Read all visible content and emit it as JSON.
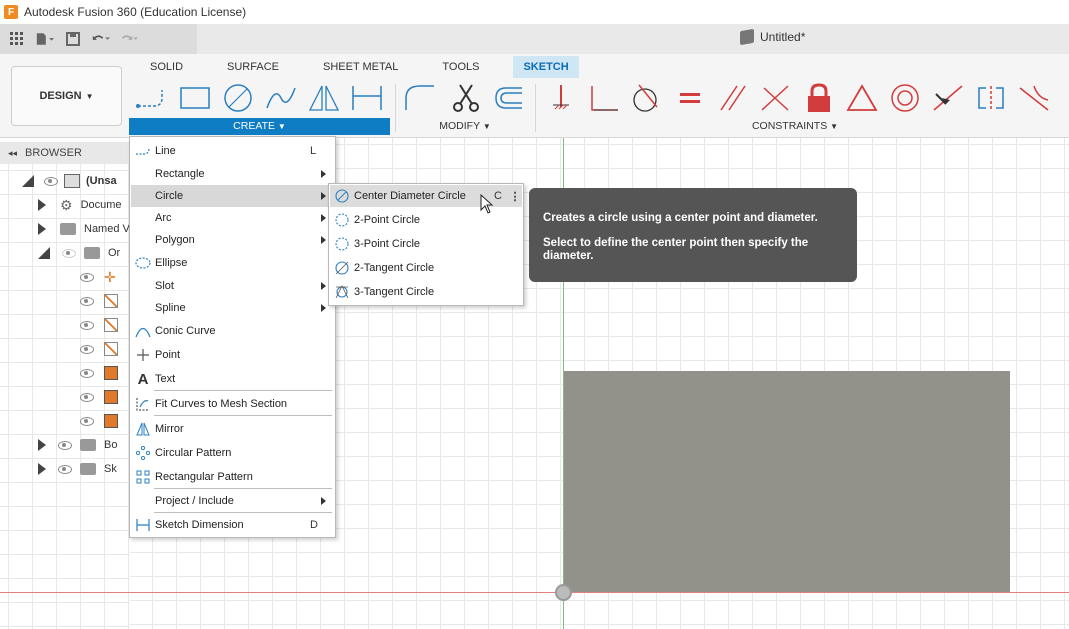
{
  "window": {
    "title": "Autodesk Fusion 360 (Education License)",
    "logo_letter": "F"
  },
  "document": {
    "name": "Untitled*"
  },
  "workspace": {
    "label": "DESIGN"
  },
  "tabs": [
    {
      "label": "SOLID",
      "active": false
    },
    {
      "label": "SURFACE",
      "active": false
    },
    {
      "label": "SHEET METAL",
      "active": false
    },
    {
      "label": "TOOLS",
      "active": false
    },
    {
      "label": "SKETCH",
      "active": true
    }
  ],
  "groups": {
    "create": "CREATE",
    "modify": "MODIFY",
    "constraints": "CONSTRAINTS"
  },
  "browser": {
    "title": "BROWSER",
    "rows": [
      {
        "label": "(Unsa",
        "bold": true
      },
      {
        "label": "Docume"
      },
      {
        "label": "Named V"
      },
      {
        "label": "Or"
      },
      {
        "label": ""
      },
      {
        "label": ""
      },
      {
        "label": ""
      },
      {
        "label": ""
      },
      {
        "label": ""
      },
      {
        "label": ""
      },
      {
        "label": ""
      },
      {
        "label": "Bo"
      },
      {
        "label": "Sk"
      }
    ]
  },
  "create_menu": {
    "items": [
      {
        "label": "Line",
        "shortcut": "L",
        "submenu": false
      },
      {
        "label": "Rectangle",
        "shortcut": "",
        "submenu": true
      },
      {
        "label": "Circle",
        "shortcut": "",
        "submenu": true,
        "highlighted": true
      },
      {
        "label": "Arc",
        "shortcut": "",
        "submenu": true
      },
      {
        "label": "Polygon",
        "shortcut": "",
        "submenu": true
      },
      {
        "label": "Ellipse",
        "shortcut": "",
        "submenu": false
      },
      {
        "label": "Slot",
        "shortcut": "",
        "submenu": true
      },
      {
        "label": "Spline",
        "shortcut": "",
        "submenu": true
      },
      {
        "label": "Conic Curve",
        "shortcut": "",
        "submenu": false
      },
      {
        "label": "Point",
        "shortcut": "",
        "submenu": false
      },
      {
        "label": "Text",
        "shortcut": "",
        "submenu": false
      },
      {
        "label": "Fit Curves to Mesh Section",
        "shortcut": "",
        "submenu": false
      },
      {
        "label": "Mirror",
        "shortcut": "",
        "submenu": false
      },
      {
        "label": "Circular Pattern",
        "shortcut": "",
        "submenu": false
      },
      {
        "label": "Rectangular Pattern",
        "shortcut": "",
        "submenu": false
      },
      {
        "label": "Project / Include",
        "shortcut": "",
        "submenu": true
      },
      {
        "label": "Sketch Dimension",
        "shortcut": "D",
        "submenu": false
      }
    ]
  },
  "circle_submenu": {
    "items": [
      {
        "label": "Center Diameter Circle",
        "shortcut": "C",
        "highlighted": true
      },
      {
        "label": "2-Point Circle",
        "shortcut": ""
      },
      {
        "label": "3-Point Circle",
        "shortcut": ""
      },
      {
        "label": "2-Tangent Circle",
        "shortcut": ""
      },
      {
        "label": "3-Tangent Circle",
        "shortcut": ""
      }
    ]
  },
  "tooltip": {
    "line1": "Creates a circle using a center point and diameter.",
    "line2": "Select to define the center point then specify the diameter."
  },
  "colors": {
    "accent": "#0f7dc4",
    "tab_active_bg": "#cfe6f5",
    "constraint_red": "#d23c3c",
    "tool_blue": "#2a7fc0"
  }
}
